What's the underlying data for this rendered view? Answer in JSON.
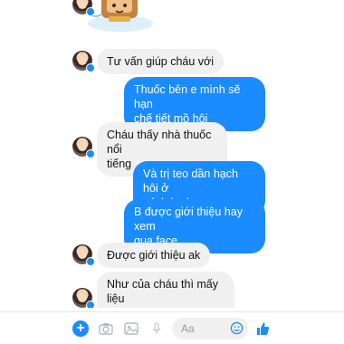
{
  "messages": [
    {
      "id": "m1",
      "side": "in",
      "text": "Tư vấn giúp cháu với"
    },
    {
      "id": "m2",
      "side": "out",
      "text": "Thuốc bên e mình sẽ hạn\nchế tiết mồ hôi"
    },
    {
      "id": "m3",
      "side": "in",
      "text": "Cháu thấy nhà thuốc nổi\ntiếng"
    },
    {
      "id": "m4",
      "side": "out",
      "text": "Và trị teo dần hạch hôi ở\nnách b ah"
    },
    {
      "id": "m5",
      "side": "out",
      "text": "B được giới thiệu hay xem\nqua face"
    },
    {
      "id": "m6",
      "side": "in",
      "text": "Được giới thiệu ak"
    },
    {
      "id": "m7",
      "side": "in",
      "text": "Như của cháu thì mấy liệu\ntrình điều trị ak"
    }
  ],
  "composer": {
    "placeholder": "Aa",
    "icons": [
      "plus-icon",
      "camera-icon",
      "image-icon",
      "mic-icon",
      "emoji-icon",
      "like-icon"
    ]
  },
  "colors": {
    "accent": "#1a8cff",
    "incoming_bubble": "#f1f0f0",
    "outgoing_text": "#ffffff"
  }
}
